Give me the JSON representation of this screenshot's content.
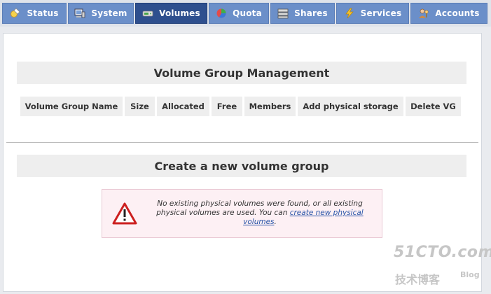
{
  "tabs": [
    {
      "label": "Status",
      "icon": "status-icon",
      "active": false
    },
    {
      "label": "System",
      "icon": "system-icon",
      "active": false
    },
    {
      "label": "Volumes",
      "icon": "volumes-icon",
      "active": true
    },
    {
      "label": "Quota",
      "icon": "quota-icon",
      "active": false
    },
    {
      "label": "Shares",
      "icon": "shares-icon",
      "active": false
    },
    {
      "label": "Services",
      "icon": "services-icon",
      "active": false
    },
    {
      "label": "Accounts",
      "icon": "accounts-icon",
      "active": false
    }
  ],
  "vg_management": {
    "title": "Volume Group Management",
    "columns": [
      "Volume Group Name",
      "Size",
      "Allocated",
      "Free",
      "Members",
      "Add physical storage",
      "Delete VG"
    ]
  },
  "create_vg": {
    "title": "Create a new volume group",
    "message_prefix": "No existing physical volumes were found, or all existing physical volumes are used. You can ",
    "link_text": "create new physical volumes",
    "message_suffix": "."
  },
  "watermark": {
    "top": "51CTO.com",
    "cn": "技术博客",
    "blog": "Blog"
  },
  "colors": {
    "tab": "#6b8fc9",
    "tab_active": "#2e4f8e",
    "header_bg": "#eeeeee",
    "warning_bg": "#fdf0f4",
    "warning_red": "#cc1f1f",
    "link": "#2a55a8"
  }
}
